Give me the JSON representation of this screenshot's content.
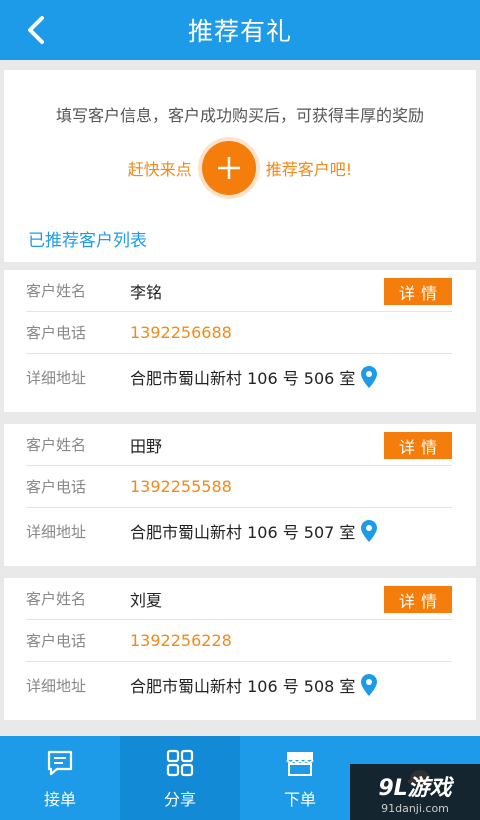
{
  "header": {
    "title": "推荐有礼"
  },
  "intro": {
    "text": "填写客户信息，客户成功购买后，可获得丰厚的奖励",
    "cta_left": "赶快来点",
    "cta_right": "推荐客户吧!",
    "list_title": "已推荐客户列表"
  },
  "labels": {
    "name": "客户姓名",
    "phone": "客户电话",
    "address": "详细地址",
    "detail": "详情"
  },
  "customers": [
    {
      "name": "李铭",
      "phone": "1392256688",
      "address": "合肥市蜀山新村 106 号 506 室"
    },
    {
      "name": "田野",
      "phone": "1392255588",
      "address": "合肥市蜀山新村 106 号 507 室"
    },
    {
      "name": "刘夏",
      "phone": "1392256228",
      "address": "合肥市蜀山新村 106 号 508 室"
    }
  ],
  "tabs": [
    {
      "label": "接单",
      "icon": "message-icon"
    },
    {
      "label": "分享",
      "icon": "grid-icon"
    },
    {
      "label": "下单",
      "icon": "store-icon"
    },
    {
      "label": "",
      "icon": "helmet-icon"
    }
  ],
  "watermark": {
    "logo": "9L游戏",
    "url": "91danji.com"
  },
  "colors": {
    "primary": "#1e9be8",
    "accent": "#f57d0b",
    "phone": "#f08a1c"
  }
}
